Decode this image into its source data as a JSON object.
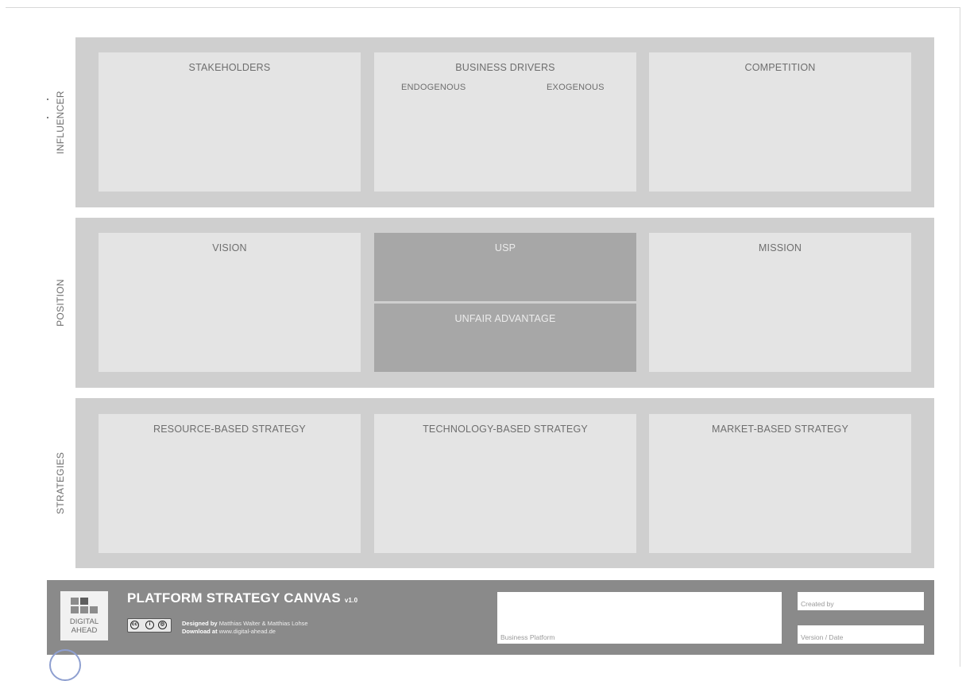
{
  "rows": {
    "influencer": "INFLUENCER",
    "position": "POSITION",
    "strategies": "STRATEGIES"
  },
  "influencer": {
    "stakeholders": "STAKEHOLDERS",
    "business_drivers": "BUSINESS DRIVERS",
    "endogenous": "ENDOGENOUS",
    "exogenous": "EXOGENOUS",
    "competition": "COMPETITION"
  },
  "position": {
    "vision": "VISION",
    "usp": "USP",
    "unfair_advantage": "UNFAIR ADVANTAGE",
    "mission": "MISSION"
  },
  "strategies": {
    "resource": "RESOURCE-BASED STRATEGY",
    "technology": "TECHNOLOGY-BASED STRATEGY",
    "market": "MARKET-BASED STRATEGY"
  },
  "footer": {
    "logo_line1": "DIGITAL",
    "logo_line2": "AHEAD",
    "title": "PLATFORM STRATEGY CANVAS",
    "version": "v1.0",
    "designed_label": "Designed by",
    "designed_value": "Matthias Walter & Matthias Lohse",
    "download_label": "Download at",
    "download_value": "www.digital-ahead.de",
    "business_platform": "Business Platform",
    "created_by": "Created by",
    "version_date": "Version / Date"
  },
  "colors": {
    "band": "#cfcfcf",
    "cell": "#e4e4e4",
    "highlight_cell": "#a7a7a7",
    "footer": "#8a8a8a"
  }
}
